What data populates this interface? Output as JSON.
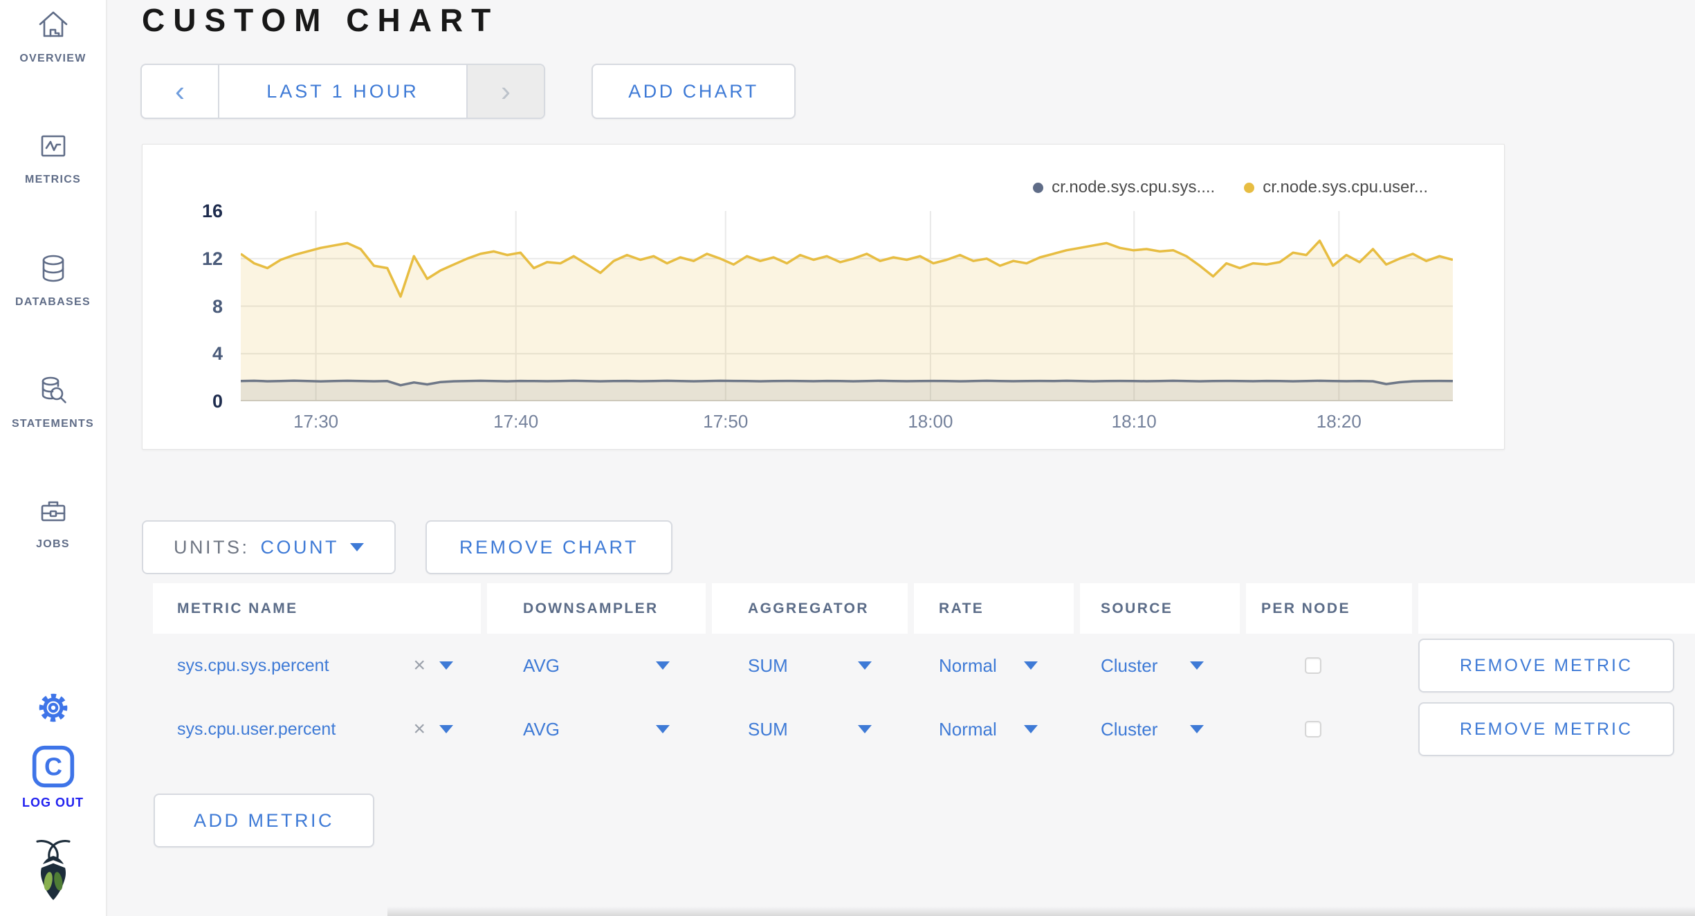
{
  "header": {
    "title": "CUSTOM CHART"
  },
  "sidebar": {
    "items": [
      {
        "id": "overview",
        "label": "OVERVIEW"
      },
      {
        "id": "metrics",
        "label": "METRICS"
      },
      {
        "id": "databases",
        "label": "DATABASES"
      },
      {
        "id": "statements",
        "label": "STATEMENTS"
      },
      {
        "id": "jobs",
        "label": "JOBS"
      }
    ],
    "logout_label": "LOG OUT",
    "logo_letter": "C"
  },
  "toolbar": {
    "prev_icon": "‹",
    "next_icon": "›",
    "time_window_label": "LAST 1 HOUR",
    "add_chart_label": "ADD CHART"
  },
  "chart_controls": {
    "units_label": "UNITS:",
    "units_value": "COUNT",
    "remove_chart_label": "REMOVE CHART",
    "add_metric_label": "ADD METRIC"
  },
  "metrics_table": {
    "columns": [
      "METRIC NAME",
      "DOWNSAMPLER",
      "AGGREGATOR",
      "RATE",
      "SOURCE",
      "PER NODE"
    ],
    "clear_icon": "×",
    "rows": [
      {
        "metric_name": "sys.cpu.sys.percent",
        "downsampler": "AVG",
        "aggregator": "SUM",
        "rate": "Normal",
        "source": "Cluster",
        "per_node_checked": false,
        "action_label": "REMOVE METRIC"
      },
      {
        "metric_name": "sys.cpu.user.percent",
        "downsampler": "AVG",
        "aggregator": "SUM",
        "rate": "Normal",
        "source": "Cluster",
        "per_node_checked": false,
        "action_label": "REMOVE METRIC"
      }
    ]
  },
  "chart_data": {
    "type": "area",
    "title": "",
    "xlabel": "",
    "ylabel": "",
    "ylim": [
      0,
      16
    ],
    "y_ticks": [
      0,
      4,
      8,
      12,
      16
    ],
    "y_gridlines": [
      4,
      8,
      12
    ],
    "x_ticks": [
      "17:30",
      "17:40",
      "17:50",
      "18:00",
      "18:10",
      "18:20"
    ],
    "x_tick_fractions": [
      0.062,
      0.227,
      0.4,
      0.569,
      0.737,
      0.906
    ],
    "x_range": [
      "17:26",
      "18:26"
    ],
    "grid_on": true,
    "grid_color": "#e9e9e9",
    "axis_color": "#dcdcdc",
    "legend_position": "top-right",
    "legend": [
      {
        "name": "cr.node.sys.cpu.sys....",
        "color": "#5f6c87"
      },
      {
        "name": "cr.node.sys.cpu.user...",
        "color": "#e7bd42"
      }
    ],
    "series": [
      {
        "name": "cr.node.sys.cpu.sys....",
        "color": "#6e7787",
        "fill": "rgba(110,119,135,0.14)",
        "values": [
          1.7,
          1.72,
          1.68,
          1.7,
          1.73,
          1.7,
          1.67,
          1.7,
          1.72,
          1.7,
          1.68,
          1.7,
          1.35,
          1.58,
          1.42,
          1.62,
          1.68,
          1.7,
          1.72,
          1.7,
          1.68,
          1.71,
          1.7,
          1.69,
          1.7,
          1.72,
          1.7,
          1.68,
          1.7,
          1.71,
          1.69,
          1.7,
          1.72,
          1.7,
          1.68,
          1.7,
          1.72,
          1.71,
          1.7,
          1.68,
          1.7,
          1.71,
          1.7,
          1.69,
          1.71,
          1.7,
          1.68,
          1.7,
          1.72,
          1.7,
          1.69,
          1.7,
          1.71,
          1.7,
          1.68,
          1.7,
          1.72,
          1.7,
          1.69,
          1.7,
          1.71,
          1.7,
          1.72,
          1.7,
          1.68,
          1.7,
          1.71,
          1.7,
          1.69,
          1.7,
          1.72,
          1.7,
          1.68,
          1.7,
          1.71,
          1.7,
          1.69,
          1.71,
          1.7,
          1.68,
          1.7,
          1.72,
          1.7,
          1.69,
          1.7,
          1.68,
          1.45,
          1.6,
          1.68,
          1.7,
          1.71,
          1.7
        ]
      },
      {
        "name": "cr.node.sys.cpu.user...",
        "color": "#e7bd42",
        "fill": "rgba(231,189,66,0.16)",
        "values": [
          12.4,
          11.6,
          11.2,
          11.9,
          12.3,
          12.6,
          12.9,
          13.1,
          13.3,
          12.8,
          11.4,
          11.2,
          8.8,
          12.2,
          10.3,
          11.0,
          11.5,
          12.0,
          12.4,
          12.6,
          12.3,
          12.5,
          11.2,
          11.7,
          11.6,
          12.2,
          11.5,
          10.8,
          11.8,
          12.3,
          11.9,
          12.2,
          11.6,
          12.1,
          11.8,
          12.4,
          12.0,
          11.5,
          12.2,
          11.8,
          12.1,
          11.6,
          12.3,
          11.9,
          12.2,
          11.7,
          12.0,
          12.4,
          11.8,
          12.1,
          11.9,
          12.2,
          11.6,
          11.9,
          12.3,
          11.8,
          12.0,
          11.4,
          11.8,
          11.6,
          12.1,
          12.4,
          12.7,
          12.9,
          13.1,
          13.3,
          12.9,
          12.7,
          12.8,
          12.6,
          12.7,
          12.2,
          11.4,
          10.5,
          11.6,
          11.2,
          11.6,
          11.5,
          11.7,
          12.5,
          12.3,
          13.5,
          11.4,
          12.3,
          11.7,
          12.8,
          11.5,
          12.0,
          12.4,
          11.8,
          12.2,
          11.9
        ]
      }
    ]
  }
}
